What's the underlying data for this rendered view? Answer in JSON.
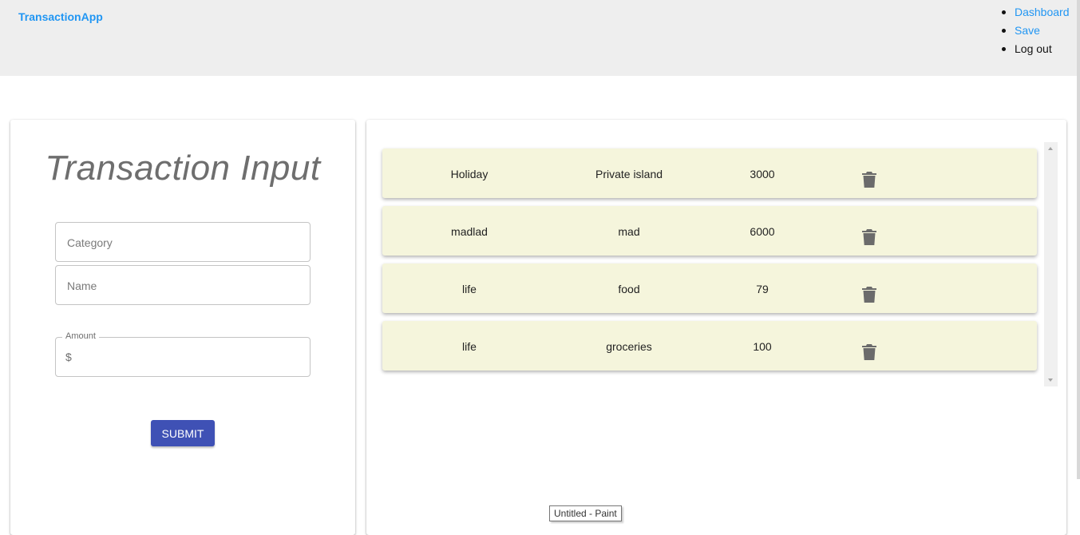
{
  "header": {
    "brand": "TransactionApp",
    "nav": [
      {
        "label": "Dashboard"
      },
      {
        "label": "Save"
      },
      {
        "label": "Log out"
      }
    ]
  },
  "form": {
    "title": "Transaction Input",
    "category_placeholder": "Category",
    "name_placeholder": "Name",
    "amount_label": "Amount",
    "amount_prefix": "$",
    "submit_label": "SUBMIT"
  },
  "transactions": [
    {
      "category": "Holiday",
      "name": "Private island",
      "amount": "3000"
    },
    {
      "category": "madlad",
      "name": "mad",
      "amount": "6000"
    },
    {
      "category": "life",
      "name": "food",
      "amount": "79"
    },
    {
      "category": "life",
      "name": "groceries",
      "amount": "100"
    }
  ],
  "icons": {
    "delete": "trash-icon"
  },
  "colors": {
    "brand": "#2196f3",
    "header_bg": "#eeeeee",
    "row_bg": "#f5f5dc",
    "submit_bg": "#3f51b5"
  },
  "tooltip": "Untitled - Paint"
}
